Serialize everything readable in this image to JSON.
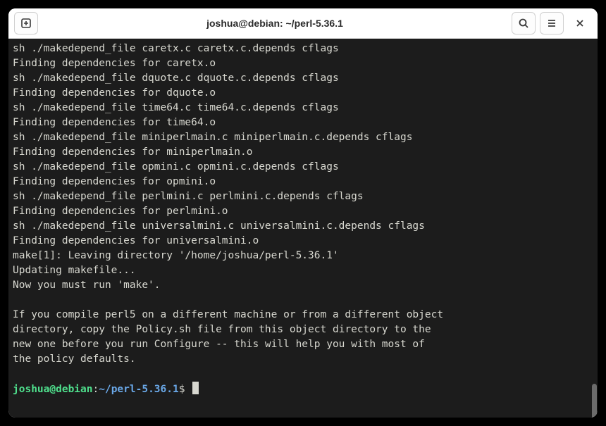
{
  "window": {
    "title": "joshua@debian: ~/perl-5.36.1"
  },
  "terminal": {
    "output": "sh ./makedepend_file caretx.c caretx.c.depends cflags\nFinding dependencies for caretx.o\nsh ./makedepend_file dquote.c dquote.c.depends cflags\nFinding dependencies for dquote.o\nsh ./makedepend_file time64.c time64.c.depends cflags\nFinding dependencies for time64.o\nsh ./makedepend_file miniperlmain.c miniperlmain.c.depends cflags\nFinding dependencies for miniperlmain.o\nsh ./makedepend_file opmini.c opmini.c.depends cflags\nFinding dependencies for opmini.o\nsh ./makedepend_file perlmini.c perlmini.c.depends cflags\nFinding dependencies for perlmini.o\nsh ./makedepend_file universalmini.c universalmini.c.depends cflags\nFinding dependencies for universalmini.o\nmake[1]: Leaving directory '/home/joshua/perl-5.36.1'\nUpdating makefile...\nNow you must run 'make'.\n\nIf you compile perl5 on a different machine or from a different object\ndirectory, copy the Policy.sh file from this object directory to the\nnew one before you run Configure -- this will help you with most of\nthe policy defaults.\n",
    "prompt": {
      "user_host": "joshua@debian",
      "separator": ":",
      "path": "~/perl-5.36.1",
      "end": "$ "
    }
  }
}
